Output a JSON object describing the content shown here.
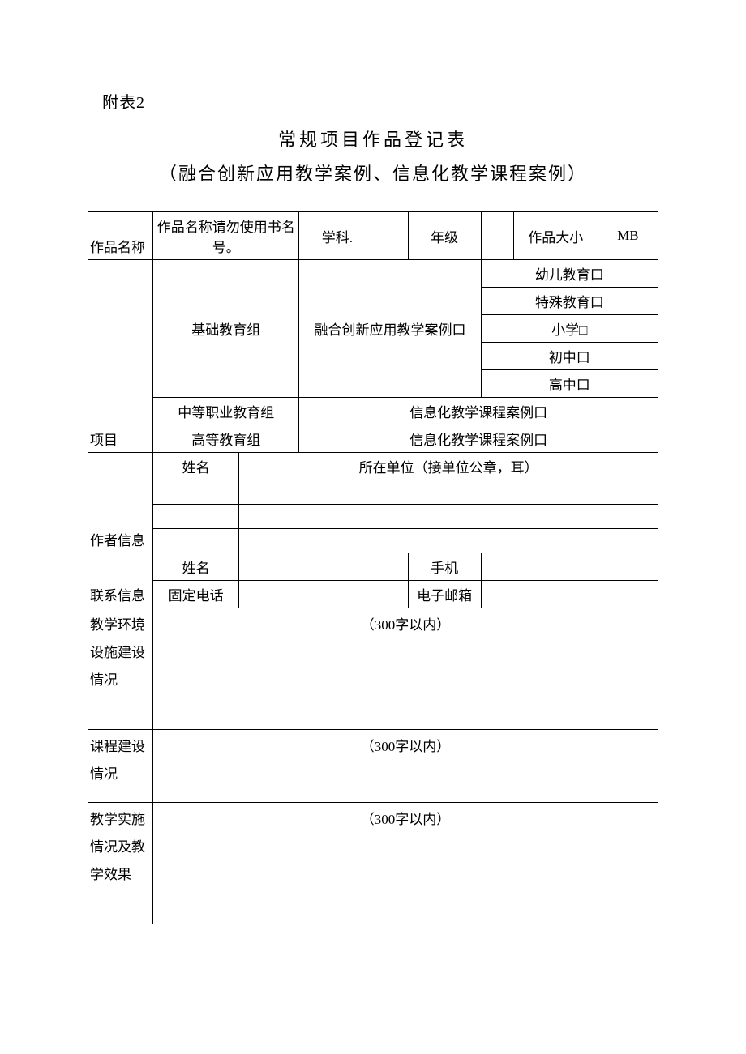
{
  "header_label": "附表2",
  "title": "常规项目作品登记表",
  "subtitle": "（融合创新应用教学案例、信息化教学课程案例）",
  "row_work": {
    "label": "作品名称",
    "name_hint": "作品名称请勿使用书名号。",
    "subject_label": "学科.",
    "grade_label": "年级",
    "size_label": "作品大小",
    "size_unit": "MB"
  },
  "row_project": {
    "label": "项目",
    "group_basic": "基础教育组",
    "case_basic": "融合创新应用教学案例口",
    "opt_kinder": "幼儿教育口",
    "opt_special": "特殊教育口",
    "opt_primary": "小学□",
    "opt_junior": "初中口",
    "opt_senior": "高中口",
    "group_vocational": "中等职业教育组",
    "case_vocational": "信息化教学课程案例口",
    "group_higher": "高等教育组",
    "case_higher": "信息化教学课程案例口"
  },
  "row_author": {
    "label": "作者信息",
    "name_label": "姓名",
    "unit_label": "所在单位（接单位公章，耳）"
  },
  "row_contact": {
    "label": "联系信息",
    "name_label": "姓名",
    "mobile_label": "手机",
    "phone_label": "固定电话",
    "email_label": "电子邮箱"
  },
  "row_env": {
    "label": "教学环境设施建设情况",
    "hint": "（300字以内）"
  },
  "row_course": {
    "label": "课程建设情况",
    "hint": "（300字以内）"
  },
  "row_effect": {
    "label": "教学实施情况及教学效果",
    "hint": "（300字以内）"
  }
}
